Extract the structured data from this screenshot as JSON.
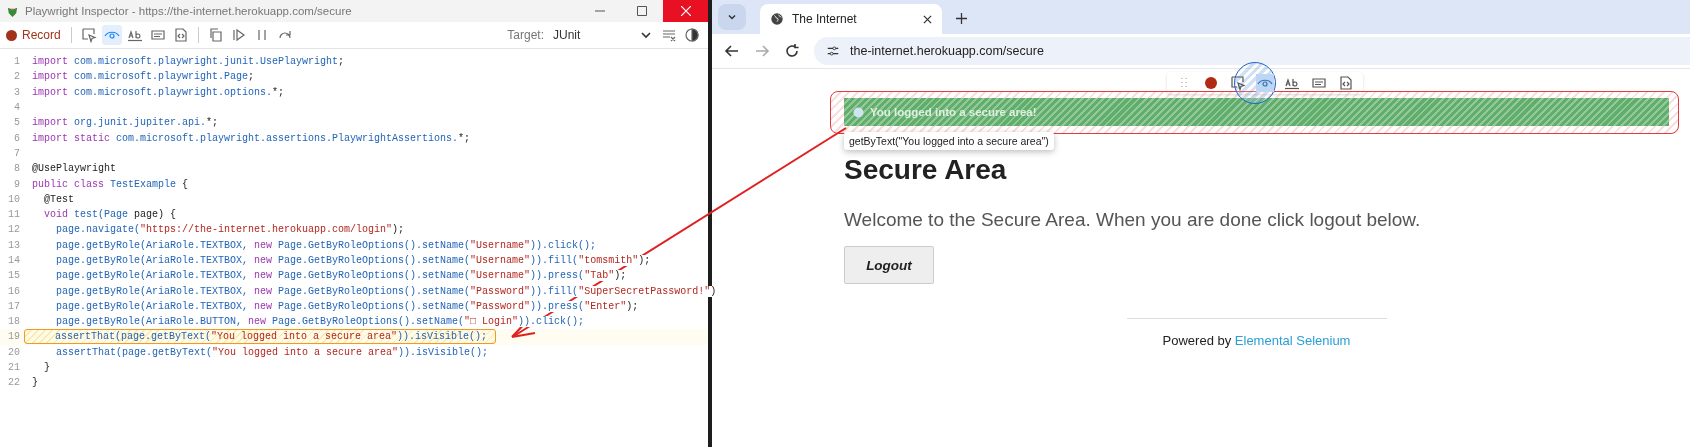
{
  "inspector": {
    "title": "Playwright Inspector - https://the-internet.herokuapp.com/secure",
    "toolbar": {
      "record": {
        "label": "Record",
        "on": true
      },
      "tools": [
        {
          "kind": "pick",
          "selected": false
        },
        {
          "kind": "eye",
          "selected": true
        },
        {
          "kind": "ab",
          "selected": false
        },
        {
          "kind": "value",
          "selected": false
        },
        {
          "kind": "snapshot",
          "selected": false
        },
        {
          "kind": "sep",
          "selected": false
        },
        {
          "kind": "copy",
          "selected": false
        },
        {
          "kind": "resume",
          "selected": false
        },
        {
          "kind": "pause",
          "selected": false
        },
        {
          "kind": "step",
          "selected": false
        }
      ],
      "target_label": "Target:",
      "target_value": "JUnit"
    },
    "code_lines": [
      {
        "number": "1",
        "highlighted": false,
        "tokens": [
          {
            "kind": "kw",
            "text": "import "
          },
          {
            "kind": "id",
            "text": "com.microsoft.playwright.junit.UsePlaywright"
          },
          {
            "kind": "plain",
            "text": ";"
          }
        ]
      },
      {
        "number": "2",
        "highlighted": false,
        "tokens": [
          {
            "kind": "kw",
            "text": "import "
          },
          {
            "kind": "id",
            "text": "com.microsoft.playwright.Page"
          },
          {
            "kind": "plain",
            "text": ";"
          }
        ]
      },
      {
        "number": "3",
        "highlighted": false,
        "tokens": [
          {
            "kind": "kw",
            "text": "import "
          },
          {
            "kind": "id",
            "text": "com.microsoft.playwright.options."
          },
          {
            "kind": "plain",
            "text": "*;"
          }
        ]
      },
      {
        "number": "4",
        "highlighted": false
      },
      {
        "number": "5",
        "highlighted": false,
        "tokens": [
          {
            "kind": "kw",
            "text": "import "
          },
          {
            "kind": "id",
            "text": "org.junit.jupiter.api."
          },
          {
            "kind": "plain",
            "text": "*;"
          }
        ]
      },
      {
        "number": "6",
        "highlighted": false,
        "tokens": [
          {
            "kind": "kw",
            "text": "import static "
          },
          {
            "kind": "id",
            "text": "com.microsoft.playwright.assertions.PlaywrightAssertions."
          },
          {
            "kind": "plain",
            "text": "*;"
          }
        ]
      },
      {
        "number": "7",
        "highlighted": false
      },
      {
        "number": "8",
        "highlighted": false,
        "tokens": [
          {
            "kind": "plain",
            "text": "@UsePlaywright"
          }
        ]
      },
      {
        "number": "9",
        "highlighted": false,
        "tokens": [
          {
            "kind": "kw",
            "text": "public class "
          },
          {
            "kind": "id",
            "text": "TestExample"
          },
          {
            "kind": "plain",
            "text": " {"
          }
        ]
      },
      {
        "number": "10",
        "highlighted": false,
        "tokens": [
          {
            "kind": "plain",
            "text": "  @Test"
          }
        ]
      },
      {
        "number": "11",
        "highlighted": false,
        "tokens": [
          {
            "kind": "kw",
            "text": "  void "
          },
          {
            "kind": "id",
            "text": "test(Page "
          },
          {
            "kind": "plain",
            "text": "page) {"
          }
        ]
      },
      {
        "number": "12",
        "highlighted": false,
        "tokens": [
          {
            "kind": "id",
            "text": "    page.navigate("
          },
          {
            "kind": "str",
            "text": "\"https://the-internet.herokuapp.com/login\""
          },
          {
            "kind": "plain",
            "text": ");"
          }
        ]
      },
      {
        "number": "13",
        "highlighted": false,
        "tokens": [
          {
            "kind": "id",
            "text": "    page.getByRole(AriaRole.TEXTBOX, "
          },
          {
            "kind": "kw",
            "text": "new "
          },
          {
            "kind": "id",
            "text": "Page.GetByRoleOptions().setName("
          },
          {
            "kind": "str",
            "text": "\"Username\""
          },
          {
            "kind": "id",
            "text": ")).click();"
          }
        ]
      },
      {
        "number": "14",
        "highlighted": false,
        "tokens": [
          {
            "kind": "id",
            "text": "    page.getByRole(AriaRole.TEXTBOX, "
          },
          {
            "kind": "kw",
            "text": "new "
          },
          {
            "kind": "id",
            "text": "Page.GetByRoleOptions().setName("
          },
          {
            "kind": "str",
            "text": "\"Username\""
          },
          {
            "kind": "id",
            "text": ")).fill("
          },
          {
            "kind": "str",
            "text": "\"tomsmith\""
          },
          {
            "kind": "plain",
            "text": ");"
          }
        ]
      },
      {
        "number": "15",
        "highlighted": false,
        "tokens": [
          {
            "kind": "id",
            "text": "    page.getByRole(AriaRole.TEXTBOX, "
          },
          {
            "kind": "kw",
            "text": "new "
          },
          {
            "kind": "id",
            "text": "Page.GetByRoleOptions().setName("
          },
          {
            "kind": "str",
            "text": "\"Username\""
          },
          {
            "kind": "id",
            "text": ")).press("
          },
          {
            "kind": "str",
            "text": "\"Tab\""
          },
          {
            "kind": "plain",
            "text": ");"
          }
        ]
      },
      {
        "number": "16",
        "highlighted": false,
        "tokens": [
          {
            "kind": "id",
            "text": "    page.getByRole(AriaRole.TEXTBOX, "
          },
          {
            "kind": "kw",
            "text": "new "
          },
          {
            "kind": "id",
            "text": "Page.GetByRoleOptions().setName("
          },
          {
            "kind": "str",
            "text": "\"Password\""
          },
          {
            "kind": "id",
            "text": ")).fill("
          },
          {
            "kind": "str",
            "text": "\"SuperSecretPassword!\""
          },
          {
            "kind": "plain",
            "text": ")"
          }
        ]
      },
      {
        "number": "17",
        "highlighted": false,
        "tokens": [
          {
            "kind": "id",
            "text": "    page.getByRole(AriaRole.TEXTBOX, "
          },
          {
            "kind": "kw",
            "text": "new "
          },
          {
            "kind": "id",
            "text": "Page.GetByRoleOptions().setName("
          },
          {
            "kind": "str",
            "text": "\"Password\""
          },
          {
            "kind": "id",
            "text": ")).press("
          },
          {
            "kind": "str",
            "text": "\"Enter\""
          },
          {
            "kind": "plain",
            "text": ");"
          }
        ]
      },
      {
        "number": "18",
        "highlighted": false,
        "tokens": [
          {
            "kind": "id",
            "text": "    page.getByRole(AriaRole.BUTTON, "
          },
          {
            "kind": "kw",
            "text": "new "
          },
          {
            "kind": "id",
            "text": "Page.GetByRoleOptions().setName("
          },
          {
            "kind": "str",
            "text": "\"□ Login\""
          },
          {
            "kind": "id",
            "text": ")).click();"
          }
        ]
      },
      {
        "number": "19",
        "highlighted": true,
        "tokens": [
          {
            "kind": "id",
            "text": "    assertThat(page.getByText("
          },
          {
            "kind": "str",
            "text": "\"You logged into a secure area\""
          },
          {
            "kind": "id",
            "text": ")).isVisible();"
          }
        ]
      },
      {
        "number": "20",
        "highlighted": false,
        "tokens": [
          {
            "kind": "id",
            "text": "    assertThat(page.getByText("
          },
          {
            "kind": "str",
            "text": "\"You logged into a secure area\""
          },
          {
            "kind": "id",
            "text": ")).isVisible();"
          }
        ]
      },
      {
        "number": "21",
        "highlighted": false,
        "tokens": [
          {
            "kind": "plain",
            "text": "  }"
          }
        ]
      },
      {
        "number": "22",
        "highlighted": false,
        "tokens": [
          {
            "kind": "plain",
            "text": "}"
          }
        ]
      }
    ]
  },
  "browser": {
    "tab": {
      "title": "The Internet",
      "selected": true
    },
    "url": "the-internet.herokuapp.com/secure",
    "overlay_tools": [
      {
        "kind": "drag",
        "selected": false
      },
      {
        "kind": "record",
        "selected": false
      },
      {
        "kind": "pick",
        "selected": false
      },
      {
        "kind": "eye",
        "selected": true
      },
      {
        "kind": "ab",
        "selected": false
      },
      {
        "kind": "value",
        "selected": false
      },
      {
        "kind": "snapshot",
        "selected": false
      }
    ],
    "page": {
      "alert": "You logged into a secure area!",
      "locator_tooltip": "getByText(\"You logged into a secure area\")",
      "heading": "Secure Area",
      "paragraph": "Welcome to the Secure Area. When you are done click logout below.",
      "button": "Logout",
      "footer_text": "Powered by",
      "footer_link": "Elemental Selenium"
    }
  }
}
